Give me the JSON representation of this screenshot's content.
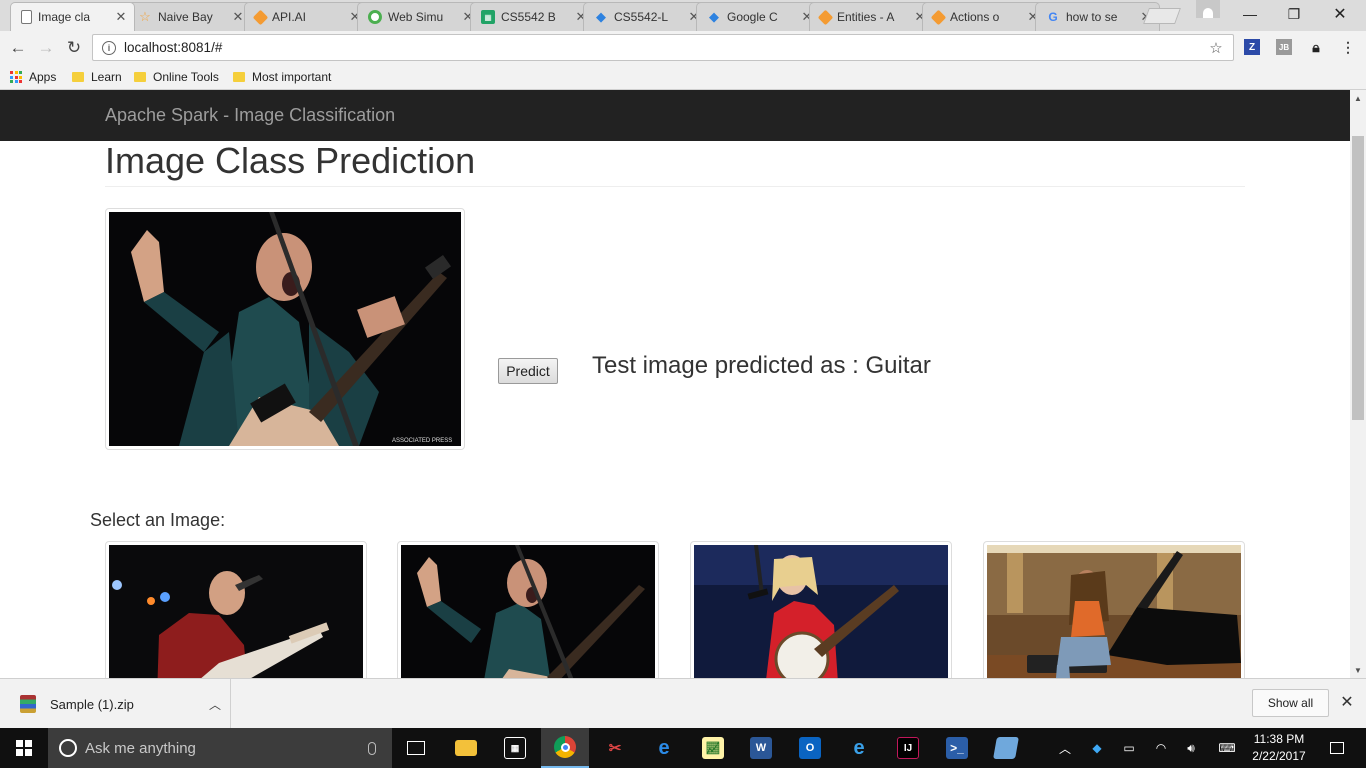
{
  "browser": {
    "tabs": [
      {
        "label": "Image cla",
        "favicon": "page-icon",
        "color": "#ffffff"
      },
      {
        "label": "Naive Bay",
        "favicon": "star-icon",
        "color": "#f4a236"
      },
      {
        "label": "API.AI",
        "favicon": "api-ai-icon",
        "color": "#f49b32"
      },
      {
        "label": "Web Simu",
        "favicon": "chrome-store-icon",
        "color": "#4caf50"
      },
      {
        "label": "CS5542 B",
        "favicon": "sheets-icon",
        "color": "#21a366"
      },
      {
        "label": "CS5542-L",
        "favicon": "dropbox-icon",
        "color": "#2d82e0"
      },
      {
        "label": "Google C",
        "favicon": "dropbox-icon",
        "color": "#2d82e0"
      },
      {
        "label": "Entities - A",
        "favicon": "api-ai-icon",
        "color": "#f49b32"
      },
      {
        "label": "Actions o",
        "favicon": "api-ai-icon",
        "color": "#f49b32"
      },
      {
        "label": "how to se",
        "favicon": "google-icon",
        "color": "#4285f4"
      }
    ],
    "url": "localhost:8081/#",
    "bookmarks": [
      {
        "label": "Apps",
        "icon": "apps-grid-icon"
      },
      {
        "label": "Learn",
        "icon": "folder-icon"
      },
      {
        "label": "Online Tools",
        "icon": "folder-icon"
      },
      {
        "label": "Most important",
        "icon": "folder-icon"
      }
    ],
    "extensions": {
      "z": "Z",
      "jb": "JB"
    }
  },
  "page": {
    "brand": "Apache Spark - Image Classification",
    "heading": "Image Class Prediction",
    "predict_label": "Predict",
    "result_text": "Test image predicted as : Guitar",
    "select_label": "Select an Image:",
    "photo_credit": "ASSOCIATED PRESS"
  },
  "downloads": {
    "file": "Sample (1).zip",
    "show_all": "Show all"
  },
  "taskbar": {
    "search_placeholder": "Ask me anything",
    "time": "11:38 PM",
    "date": "2/22/2017"
  },
  "colors": {
    "navbar": "#222222",
    "brand_text": "#9d9d9d",
    "taskbar": "#101010",
    "taskbar_accent": "#76b9ed"
  }
}
